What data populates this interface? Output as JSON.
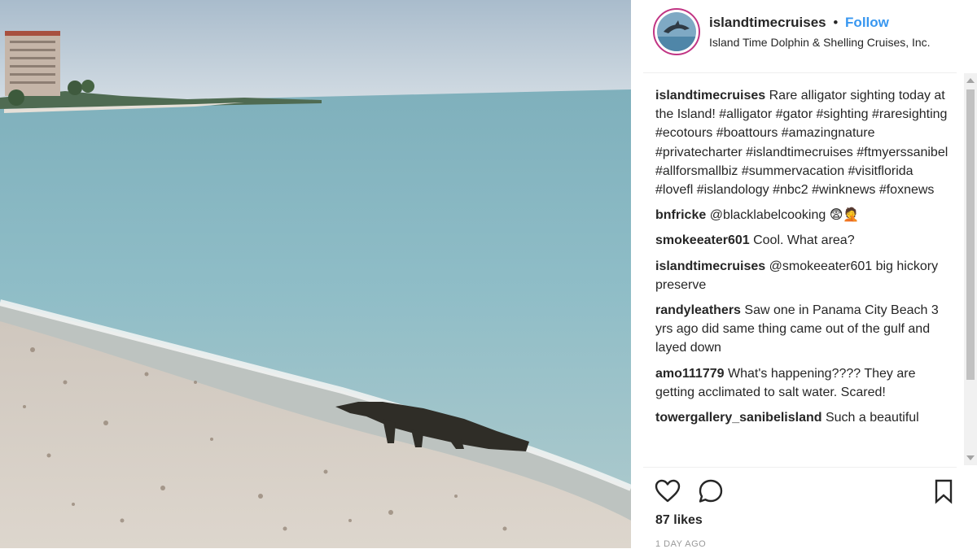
{
  "post": {
    "username": "islandtimecruises",
    "separator": "•",
    "follow_label": "Follow",
    "location": "Island Time Dolphin & Shelling Cruises, Inc."
  },
  "comments": [
    {
      "user": "islandtimecruises",
      "text": "Rare alligator sighting today at the Island! #alligator #gator #sighting #raresighting #ecotours #boattours #amazingnature #privatecharter #islandtimecruises #ftmyerssanibel #allforsmallbiz #summervacation #visitflorida #lovefl #islandology #nbc2 #winknews #foxnews"
    },
    {
      "user": "bnfricke",
      "text": "@blacklabelcooking 😨🤦"
    },
    {
      "user": "smokeeater601",
      "text": "Cool. What area?"
    },
    {
      "user": "islandtimecruises",
      "text": "@smokeeater601 big hickory preserve"
    },
    {
      "user": "randyleathers",
      "text": "Saw one in Panama City Beach 3 yrs ago did same thing came out of the gulf and layed down"
    },
    {
      "user": "amo111779",
      "text": "What's happening???? They are getting acclimated to salt water. Scared!"
    },
    {
      "user": "towergallery_sanibelisland",
      "text": "Such a beautiful"
    }
  ],
  "actions": {
    "like_icon": "heart-outline-icon",
    "comment_icon": "speech-bubble-icon",
    "save_icon": "bookmark-icon"
  },
  "likes_label": "87 likes",
  "timestamp": "1 DAY AGO",
  "colors": {
    "follow": "#3897f0",
    "text": "#262626",
    "avatar_ring": "#c13584"
  }
}
